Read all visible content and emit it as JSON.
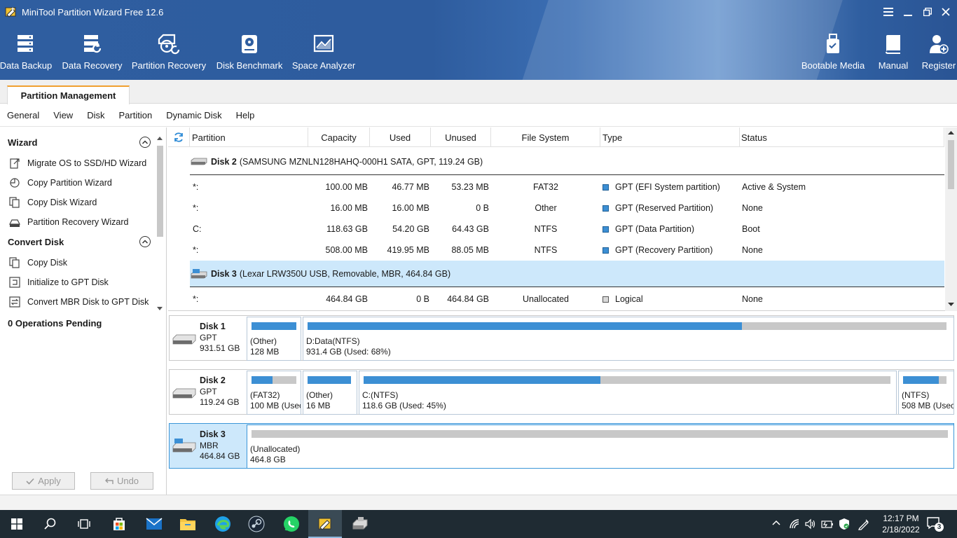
{
  "window": {
    "title": "MiniTool Partition Wizard Free 12.6"
  },
  "toolbar": {
    "left": [
      {
        "label": "Data Backup",
        "icon": "data-backup-icon"
      },
      {
        "label": "Data Recovery",
        "icon": "data-recovery-icon"
      },
      {
        "label": "Partition Recovery",
        "icon": "partition-recovery-icon"
      },
      {
        "label": "Disk Benchmark",
        "icon": "disk-benchmark-icon"
      },
      {
        "label": "Space Analyzer",
        "icon": "space-analyzer-icon"
      }
    ],
    "right": [
      {
        "label": "Bootable Media",
        "icon": "bootable-media-icon"
      },
      {
        "label": "Manual",
        "icon": "manual-icon"
      },
      {
        "label": "Register",
        "icon": "register-icon"
      }
    ]
  },
  "tabs": {
    "active": "Partition Management"
  },
  "menu": [
    "General",
    "View",
    "Disk",
    "Partition",
    "Dynamic Disk",
    "Help"
  ],
  "left_panel": {
    "wizard_title": "Wizard",
    "wizard_items": [
      "Migrate OS to SSD/HD Wizard",
      "Copy Partition Wizard",
      "Copy Disk Wizard",
      "Partition Recovery Wizard"
    ],
    "convert_title": "Convert Disk",
    "convert_items": [
      "Copy Disk",
      "Initialize to GPT Disk",
      "Convert MBR Disk to GPT Disk"
    ],
    "ops_pending": "0 Operations Pending",
    "apply_label": "Apply",
    "undo_label": "Undo"
  },
  "table": {
    "headers": [
      "Partition",
      "Capacity",
      "Used",
      "Unused",
      "File System",
      "Type",
      "Status"
    ],
    "disk2": {
      "name": "Disk 2",
      "desc": "(SAMSUNG MZNLN128HAHQ-000H1 SATA, GPT, 119.24 GB)"
    },
    "disk2_rows": [
      {
        "partition": "*:",
        "capacity": "100.00 MB",
        "used": "46.77 MB",
        "unused": "53.23 MB",
        "fs": "FAT32",
        "type": "GPT (EFI System partition)",
        "status": "Active & System"
      },
      {
        "partition": "*:",
        "capacity": "16.00 MB",
        "used": "16.00 MB",
        "unused": "0 B",
        "fs": "Other",
        "type": "GPT (Reserved Partition)",
        "status": "None"
      },
      {
        "partition": "C:",
        "capacity": "118.63 GB",
        "used": "54.20 GB",
        "unused": "64.43 GB",
        "fs": "NTFS",
        "type": "GPT (Data Partition)",
        "status": "Boot"
      },
      {
        "partition": "*:",
        "capacity": "508.00 MB",
        "used": "419.95 MB",
        "unused": "88.05 MB",
        "fs": "NTFS",
        "type": "GPT (Recovery Partition)",
        "status": "None"
      }
    ],
    "disk3": {
      "name": "Disk 3",
      "desc": "(Lexar LRW350U USB, Removable, MBR, 464.84 GB)"
    },
    "disk3_rows": [
      {
        "partition": "*:",
        "capacity": "464.84 GB",
        "used": "0 B",
        "unused": "464.84 GB",
        "fs": "Unallocated",
        "type": "Logical",
        "status": "None"
      }
    ],
    "colors": {
      "gpt": "#3c8fd4",
      "logical": "#bfbfbf",
      "selected_row": "#cde8fb"
    }
  },
  "diskmap": {
    "disk1": {
      "name": "Disk 1",
      "style": "GPT",
      "size": "931.51 GB",
      "parts": [
        {
          "l1": "(Other)",
          "l2": "128 MB",
          "used": 1.0
        },
        {
          "l1": "D:Data(NTFS)",
          "l2": "931.4 GB (Used: 68%)",
          "used": 0.68
        }
      ]
    },
    "disk2": {
      "name": "Disk 2",
      "style": "GPT",
      "size": "119.24 GB",
      "parts": [
        {
          "l1": "(FAT32)",
          "l2": "100 MB (Usec",
          "used": 0.47
        },
        {
          "l1": "(Other)",
          "l2": "16 MB",
          "used": 1.0
        },
        {
          "l1": "C:(NTFS)",
          "l2": "118.6 GB (Used: 45%)",
          "used": 0.45
        },
        {
          "l1": "(NTFS)",
          "l2": "508 MB (Usec",
          "used": 0.83
        }
      ]
    },
    "disk3": {
      "name": "Disk 3",
      "style": "MBR",
      "size": "464.84 GB",
      "parts": [
        {
          "l1": "(Unallocated)",
          "l2": "464.8 GB",
          "used": 0.0
        }
      ]
    }
  },
  "taskbar": {
    "clock_time": "12:17 PM",
    "clock_date": "2/18/2022",
    "notifications": "3"
  }
}
